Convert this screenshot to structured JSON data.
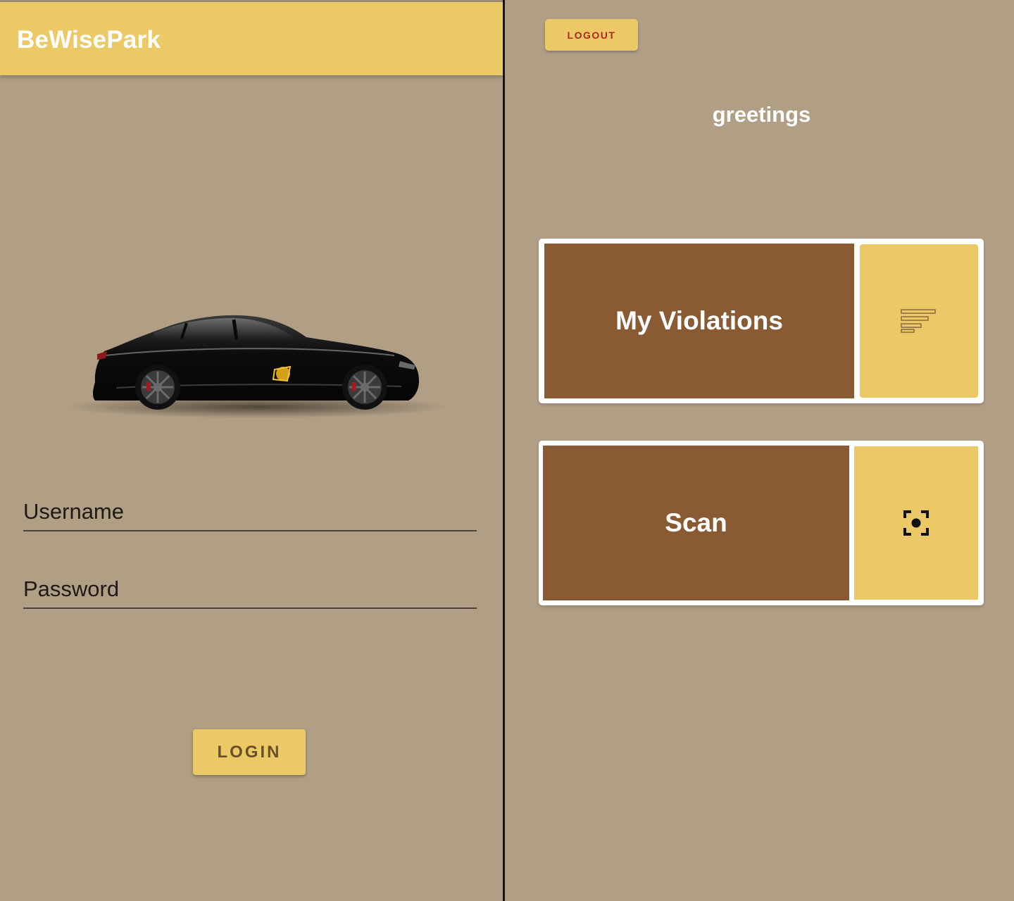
{
  "login": {
    "app_title": "BeWisePark",
    "username_placeholder": "Username",
    "password_placeholder": "Password",
    "login_label": "LOGIN"
  },
  "home": {
    "logout_label": "LOGOUT",
    "greeting": "greetings",
    "cards": [
      {
        "label": "My Violations",
        "icon": "list-icon"
      },
      {
        "label": "Scan",
        "icon": "scan-icon"
      }
    ]
  },
  "colors": {
    "background": "#b09e85",
    "accent_yellow": "#ebc966",
    "card_brown": "#8a5a33",
    "logout_text": "#b3261e"
  }
}
